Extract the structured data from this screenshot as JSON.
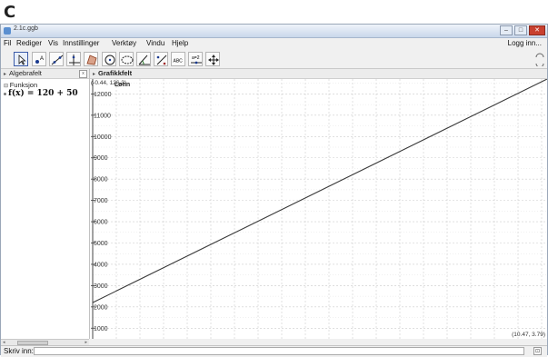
{
  "panel_letter": "C",
  "window": {
    "title": "2.1c.ggb",
    "controls": {
      "minimize": "–",
      "maximize": "□",
      "close": "✕"
    }
  },
  "menu": {
    "items": [
      "Fil",
      "Rediger",
      "Vis",
      "Innstillinger",
      "Verktøy",
      "Vindu",
      "Hjelp"
    ],
    "login": "Logg inn..."
  },
  "toolbar": {
    "tools": [
      "move-tool-icon",
      "point-tool-icon",
      "line-tool-icon",
      "perpendicular-tool-icon",
      "polygon-tool-icon",
      "circle-tool-icon",
      "conic-tool-icon",
      "angle-tool-icon",
      "reflect-tool-icon",
      "text-tool-icon",
      "slider-tool-icon",
      "move-graphics-tool-icon"
    ],
    "text_tool_label": "ABC",
    "slider_tool_label": "a=2"
  },
  "algebra": {
    "header": "Algebrafelt",
    "group": "Funksjon",
    "function_text": "f(x) = 120 + 50"
  },
  "graphics": {
    "header": "Grafikkfelt",
    "top_coords": "(-0.44, 126.3)",
    "y_axis_label": "Lønn",
    "bottom_coords": "(10.47, 3.79)"
  },
  "input_bar": {
    "label": "Skriv inn:",
    "value": "",
    "help_icon": "⊡"
  },
  "chart_data": {
    "type": "line",
    "ylabel": "Lønn",
    "yticks": [
      1000,
      2000,
      3000,
      4000,
      5000,
      6000,
      7000,
      8000,
      9000,
      10000,
      11000,
      12000
    ],
    "ylim": [
      500,
      12700
    ],
    "xlim": [
      0,
      10.47
    ],
    "grid": true,
    "series": [
      {
        "points": [
          [
            0,
            2200
          ],
          [
            10.47,
            12700
          ]
        ]
      }
    ],
    "colors": {
      "line": "#3a3a3a",
      "grid": "#cccccc",
      "axis": "#444444"
    }
  }
}
